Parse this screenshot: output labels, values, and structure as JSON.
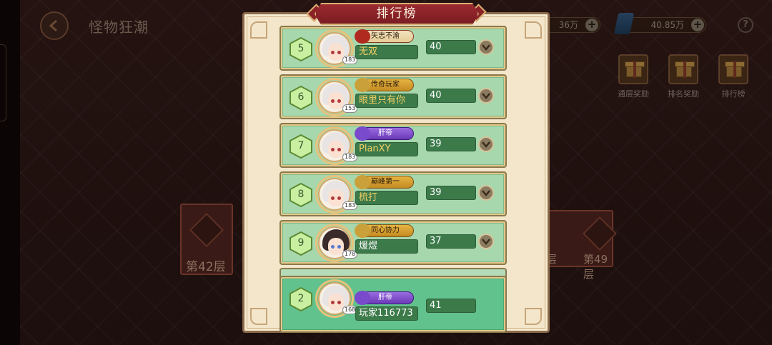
{
  "scene": {
    "title": "怪物狂潮",
    "currency": [
      {
        "value": "36万",
        "plus": "+"
      },
      {
        "value": "40.85万",
        "plus": "+"
      }
    ],
    "help": "?",
    "rewards": [
      {
        "label": "通层奖励"
      },
      {
        "label": "排名奖励"
      },
      {
        "label": "排行榜"
      }
    ],
    "floors": {
      "left": "第42层",
      "right_a": "层",
      "right_b": "第49层"
    }
  },
  "leaderboard": {
    "title": "排行榜",
    "rows": [
      {
        "rank": "5",
        "title": "矢志不渝",
        "title_style": "red",
        "name": "无双",
        "name_color": "gold",
        "level": "183",
        "score": "40",
        "avatar": "light"
      },
      {
        "rank": "6",
        "title": "传奇玩家",
        "title_style": "gold",
        "name": "眼里只有你",
        "name_color": "gold",
        "level": "153",
        "score": "40",
        "avatar": "light"
      },
      {
        "rank": "7",
        "title": "肝帝",
        "title_style": "purple",
        "name": "PlanXY",
        "name_color": "gold",
        "level": "183",
        "score": "39",
        "avatar": "light"
      },
      {
        "rank": "8",
        "title": "巅峰第一",
        "title_style": "gold",
        "name": "梳打",
        "name_color": "gold",
        "level": "183",
        "score": "39",
        "avatar": "light"
      },
      {
        "rank": "9",
        "title": "同心协力",
        "title_style": "gold",
        "name": "煖煜",
        "name_color": "white",
        "level": "178",
        "score": "37",
        "avatar": "dark"
      }
    ],
    "self": {
      "rank": "2",
      "title": "肝帝",
      "title_style": "purple",
      "name": "玩家116773",
      "name_color": "white",
      "level": "168",
      "score": "41",
      "avatar": "light"
    }
  },
  "colors": {
    "row_bg": "#a6d7ad",
    "self_bg": "#62c28e",
    "banner": "#8a2228",
    "panel": "#f3e6ca"
  }
}
